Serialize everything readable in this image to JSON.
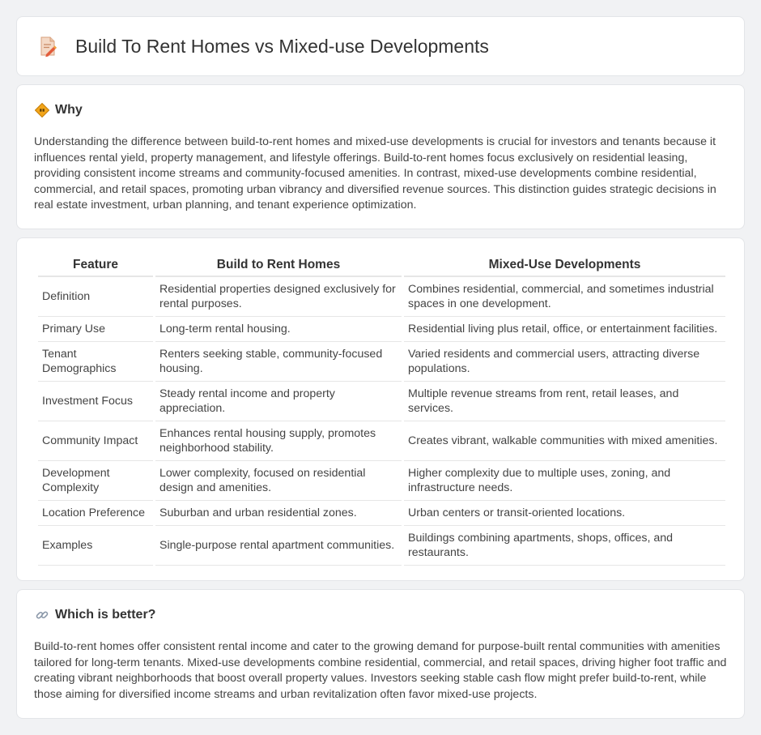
{
  "page": {
    "title": "Build To Rent Homes vs Mixed-use Developments",
    "title_icon": "document-pencil-icon"
  },
  "why": {
    "heading": "Why",
    "icon": "road-sign-icon",
    "body": "Understanding the difference between build-to-rent homes and mixed-use developments is crucial for investors and tenants because it influences rental yield, property management, and lifestyle offerings. Build-to-rent homes focus exclusively on residential leasing, providing consistent income streams and community-focused amenities. In contrast, mixed-use developments combine residential, commercial, and retail spaces, promoting urban vibrancy and diversified revenue sources. This distinction guides strategic decisions in real estate investment, urban planning, and tenant experience optimization."
  },
  "table": {
    "headers": [
      "Feature",
      "Build to Rent Homes",
      "Mixed-Use Developments"
    ],
    "rows": [
      [
        "Definition",
        "Residential properties designed exclusively for rental purposes.",
        "Combines residential, commercial, and sometimes industrial spaces in one development."
      ],
      [
        "Primary Use",
        "Long-term rental housing.",
        "Residential living plus retail, office, or entertainment facilities."
      ],
      [
        "Tenant Demographics",
        "Renters seeking stable, community-focused housing.",
        "Varied residents and commercial users, attracting diverse populations."
      ],
      [
        "Investment Focus",
        "Steady rental income and property appreciation.",
        "Multiple revenue streams from rent, retail leases, and services."
      ],
      [
        "Community Impact",
        "Enhances rental housing supply, promotes neighborhood stability.",
        "Creates vibrant, walkable communities with mixed amenities."
      ],
      [
        "Development Complexity",
        "Lower complexity, focused on residential design and amenities.",
        "Higher complexity due to multiple uses, zoning, and infrastructure needs."
      ],
      [
        "Location Preference",
        "Suburban and urban residential zones.",
        "Urban centers or transit-oriented locations."
      ],
      [
        "Examples",
        "Single-purpose rental apartment communities.",
        "Buildings combining apartments, shops, offices, and restaurants."
      ]
    ]
  },
  "better": {
    "heading": "Which is better?",
    "icon": "link-icon",
    "body": "Build-to-rent homes offer consistent rental income and cater to the growing demand for purpose-built rental communities with amenities tailored for long-term tenants. Mixed-use developments combine residential, commercial, and retail spaces, driving higher foot traffic and creating vibrant neighborhoods that boost overall property values. Investors seeking stable cash flow might prefer build-to-rent, while those aiming for diversified income streams and urban revitalization often favor mixed-use projects."
  }
}
